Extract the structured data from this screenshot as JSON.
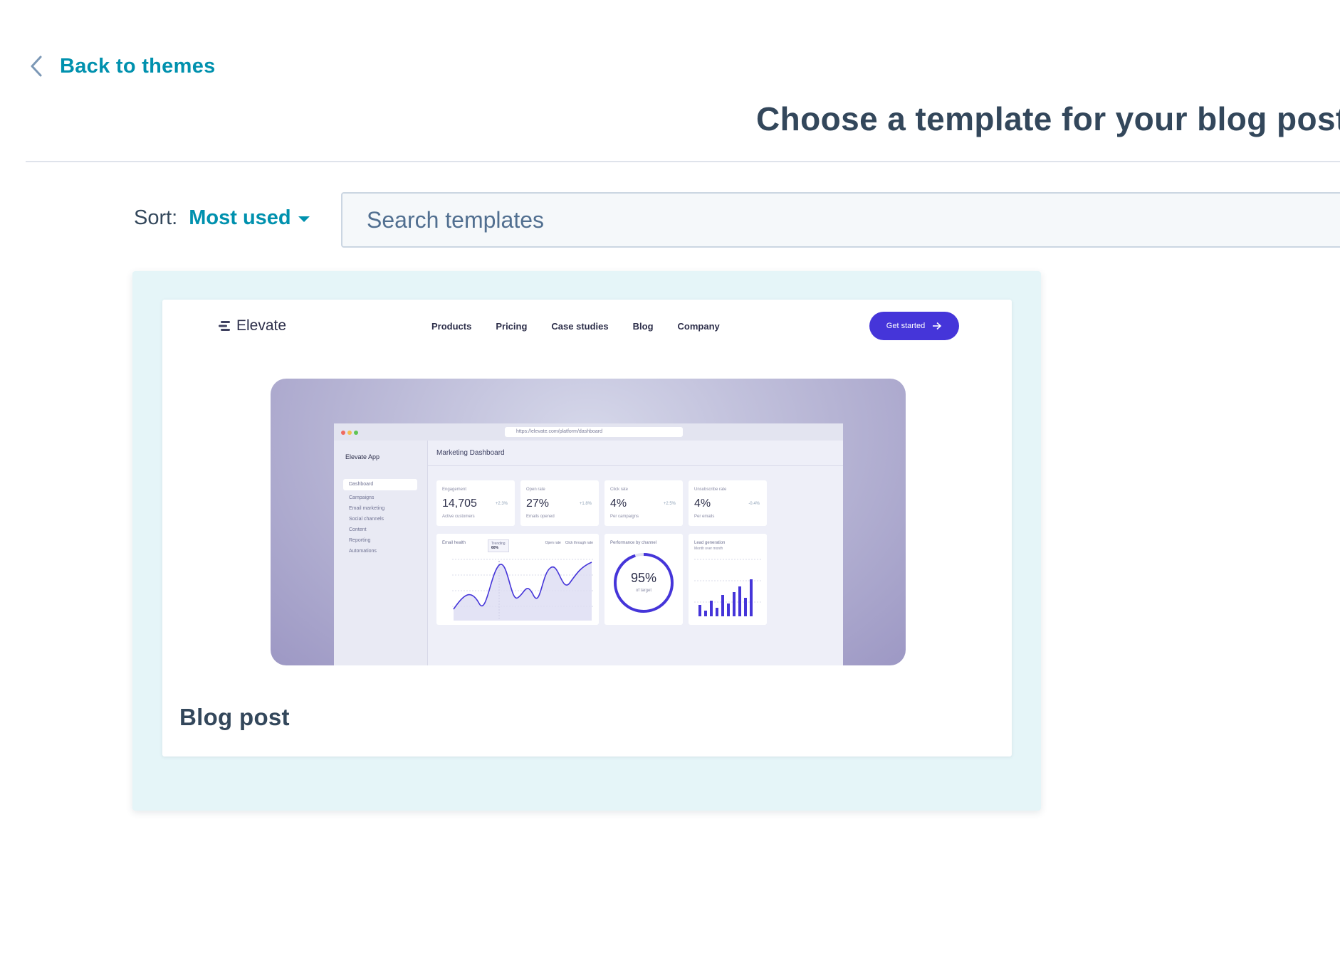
{
  "nav": {
    "back_label": "Back to themes"
  },
  "header": {
    "title": "Choose a template for your blog post"
  },
  "sort": {
    "label": "Sort:",
    "value": "Most used"
  },
  "search": {
    "placeholder": "Search templates"
  },
  "colors": {
    "accent": "#0091ae",
    "text": "#33475b",
    "card_bg": "#e5f5f8",
    "cta": "#4535d9"
  },
  "templates": [
    {
      "name": "Blog post",
      "preview": {
        "brand": "Elevate",
        "nav": [
          "Products",
          "Pricing",
          "Case studies",
          "Blog",
          "Company"
        ],
        "cta": "Get started",
        "dashboard": {
          "app_name": "Elevate App",
          "title": "Marketing Dashboard",
          "url": "https://elevate.com/platform/dashboard",
          "menu": [
            "Dashboard",
            "Campaigns",
            "Email marketing",
            "Social channels",
            "Content",
            "Reporting",
            "Automations"
          ],
          "kpis": [
            {
              "label": "Engagement",
              "value": "14,705",
              "sub": "Active customers",
              "delta": "+2.3%"
            },
            {
              "label": "Open rate",
              "value": "27%",
              "sub": "Emails opened",
              "delta": "+1.8%"
            },
            {
              "label": "Click rate",
              "value": "4%",
              "sub": "Per campaigns",
              "delta": "+2.5%"
            },
            {
              "label": "Unsubscribe rate",
              "value": "4%",
              "sub": "Per emails",
              "delta": "-0.4%"
            }
          ],
          "email_health": {
            "title": "Email health",
            "tooltip_title": "Trending",
            "tooltip_value": "60%",
            "legend": [
              "Open rate",
              "Click through rate"
            ]
          },
          "gauge": {
            "title": "Performance by channel",
            "value": "95%",
            "sub": "of target"
          },
          "leads": {
            "title": "Lead generation",
            "sub": "Month over month"
          }
        }
      }
    }
  ]
}
